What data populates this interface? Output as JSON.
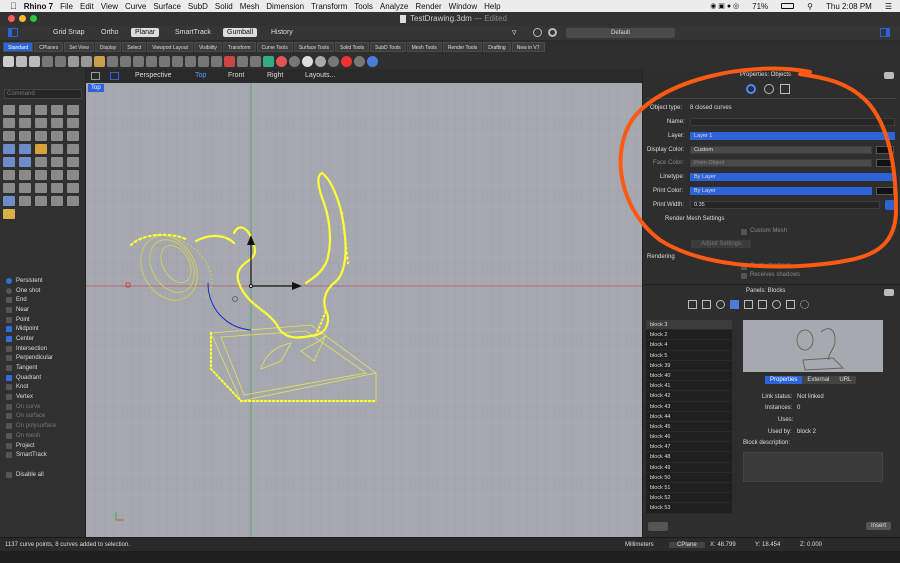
{
  "menubar": {
    "app": "Rhino 7",
    "items": [
      "File",
      "Edit",
      "View",
      "Curve",
      "Surface",
      "SubD",
      "Solid",
      "Mesh",
      "Dimension",
      "Transform",
      "Tools",
      "Analyze",
      "Render",
      "Window",
      "Help"
    ],
    "battery": "71%",
    "clock": "Thu 2:08 PM"
  },
  "titlebar": {
    "title": "TestDrawing.3dm",
    "status": "— Edited"
  },
  "modes": {
    "items": [
      "Grid Snap",
      "Ortho",
      "Planar",
      "SmartTrack",
      "Gumball",
      "History"
    ],
    "active": [
      "Planar",
      "Gumball"
    ],
    "layer": "Default"
  },
  "tabs": [
    "Standard",
    "CPlanes",
    "Set View",
    "Display",
    "Select",
    "Viewport Layout",
    "Visibility",
    "Transform",
    "Curve Tools",
    "Surface Tools",
    "Solid Tools",
    "SubD Tools",
    "Mesh Tools",
    "Render Tools",
    "Drafting",
    "New in V7"
  ],
  "command_placeholder": "Command",
  "viewport": {
    "tabs": [
      "Perspective",
      "Top",
      "Front",
      "Right",
      "Layouts..."
    ],
    "active": "Top",
    "label": "Top"
  },
  "osnaps": [
    {
      "label": "Persistent",
      "type": "radio",
      "on": true
    },
    {
      "label": "One shot",
      "type": "radio",
      "on": false
    },
    {
      "label": "End",
      "on": false
    },
    {
      "label": "Near",
      "on": false
    },
    {
      "label": "Point",
      "on": false
    },
    {
      "label": "Midpoint",
      "on": true
    },
    {
      "label": "Center",
      "on": true
    },
    {
      "label": "Intersection",
      "on": false
    },
    {
      "label": "Perpendicular",
      "on": false
    },
    {
      "label": "Tangent",
      "on": false
    },
    {
      "label": "Quadrant",
      "on": true
    },
    {
      "label": "Knot",
      "on": false
    },
    {
      "label": "Vertex",
      "on": false
    },
    {
      "label": "On curve",
      "on": false,
      "dim": true
    },
    {
      "label": "On surface",
      "on": false,
      "dim": true
    },
    {
      "label": "On polysurface",
      "on": false,
      "dim": true
    },
    {
      "label": "On mesh",
      "on": false,
      "dim": true
    },
    {
      "label": "Project",
      "on": false
    },
    {
      "label": "SmartTrack",
      "on": false
    },
    {
      "label": "",
      "on": false,
      "spacer": true
    },
    {
      "label": "Disable all",
      "on": false
    }
  ],
  "properties": {
    "header": "Properties: Objects",
    "object_type_label": "Object type:",
    "object_type_value": "8 closed curves",
    "name_label": "Name:",
    "layer_label": "Layer:",
    "layer_value": "Layer 1",
    "display_color_label": "Display Color:",
    "display_color_value": "Custom",
    "face_color_label": "Face Color:",
    "face_color_value": "From Object",
    "linetype_label": "Linetype:",
    "linetype_value": "By Layer",
    "print_color_label": "Print Color:",
    "print_color_value": "By Layer",
    "print_width_label": "Print Width:",
    "print_width_value": "0.35",
    "render_mesh_label": "Render Mesh Settings",
    "custom_mesh_label": "Custom Mesh",
    "adjust_label": "Adjust Settings",
    "rendering_label": "Rendering",
    "casts_label": "Casts shadows",
    "receives_label": "Receives shadows"
  },
  "blocks": {
    "header": "Panels: Blocks",
    "items": [
      "block 3",
      "block 2",
      "block 4",
      "block 5",
      "block 39",
      "block 40",
      "block 41",
      "block 42",
      "block 43",
      "block 44",
      "block 45",
      "block 46",
      "block 47",
      "block 48",
      "block 49",
      "block 50",
      "block 51",
      "block 52",
      "block 53"
    ],
    "tabs": [
      "Properties",
      "External",
      "URL"
    ],
    "link_status_label": "Link status:",
    "link_status_value": "Not linked",
    "instances_label": "Instances:",
    "instances_value": "0",
    "uses_label": "Uses:",
    "used_by_label": "Used by:",
    "used_by_value": "block 2",
    "description_label": "Block description:",
    "insert_label": "Insert"
  },
  "status": {
    "message": "1137 curve points, 8 curves added to selection.",
    "units": "Millimeters",
    "cplane": "CPlane",
    "x": "X: 48.799",
    "y": "Y: 18.454",
    "z": "Z: 0.000"
  },
  "colors": {
    "accent": "#2d63d9",
    "curve": "#ffff33",
    "viewport_bg": "#a6aab0",
    "annotation": "#ff5a14"
  }
}
